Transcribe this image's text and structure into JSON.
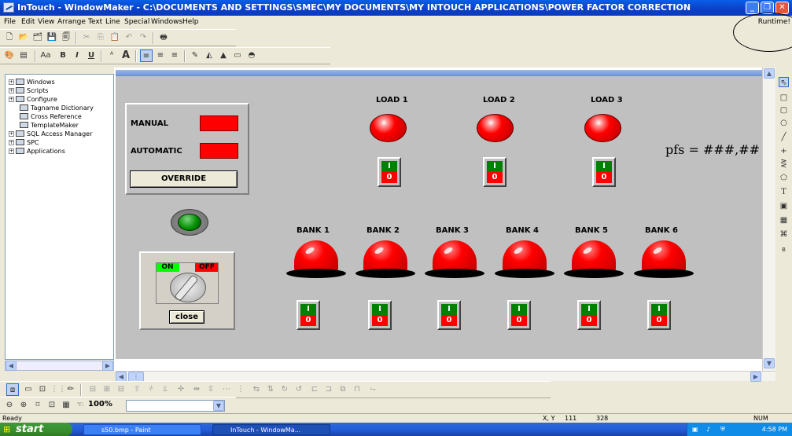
{
  "window": {
    "title": "InTouch - WindowMaker - C:\\DOCUMENTS AND SETTINGS\\SMEC\\MY DOCUMENTS\\MY INTOUCH APPLICATIONS\\POWER FACTOR CORRECTION",
    "runtime_label": "Runtime!"
  },
  "menu": [
    "File",
    "Edit",
    "View",
    "Arrange",
    "Text",
    "Line",
    "Special",
    "Windows",
    "Help"
  ],
  "toolbar3": {
    "bold": "B",
    "italic": "I",
    "underline": "U"
  },
  "tree": {
    "items": [
      {
        "label": "Windows"
      },
      {
        "label": "Scripts"
      },
      {
        "label": "Configure"
      },
      {
        "label": "Tagname Dictionary"
      },
      {
        "label": "Cross Reference"
      },
      {
        "label": "TemplateMaker"
      },
      {
        "label": "SQL Access Manager"
      },
      {
        "label": "SPC"
      },
      {
        "label": "Applications"
      }
    ]
  },
  "canvas": {
    "manual_label": "MANUAL",
    "automatic_label": "AUTOMATIC",
    "override_label": "OVERRIDE",
    "on_label": "ON",
    "off_label": "OFF",
    "close_label": "close",
    "pfs_text": "pfs = ###,##",
    "switch_on": "I",
    "switch_off": "0",
    "loads": [
      "LOAD 1",
      "LOAD 2",
      "LOAD 3"
    ],
    "banks": [
      "BANK 1",
      "BANK 2",
      "BANK 3",
      "BANK 4",
      "BANK 5",
      "BANK 6"
    ]
  },
  "palette": {
    "text_tool": "T",
    "bitmap_tool": "B"
  },
  "zoom": {
    "value": "100%"
  },
  "status": {
    "ready": "Ready",
    "coords_label": "X, Y",
    "x": "111",
    "y": "328",
    "num": "NUM"
  },
  "taskbar": {
    "start": "start",
    "tasks": [
      "s50.bmp - Paint",
      "InTouch - WindowMa..."
    ],
    "clock": "4:58 PM"
  },
  "colors": {
    "titlebar": "#0a5ee7",
    "canvas": "#c0c0c0",
    "lamp_red": "#ff0000",
    "lamp_green": "#009000",
    "switch_green": "#008000"
  }
}
